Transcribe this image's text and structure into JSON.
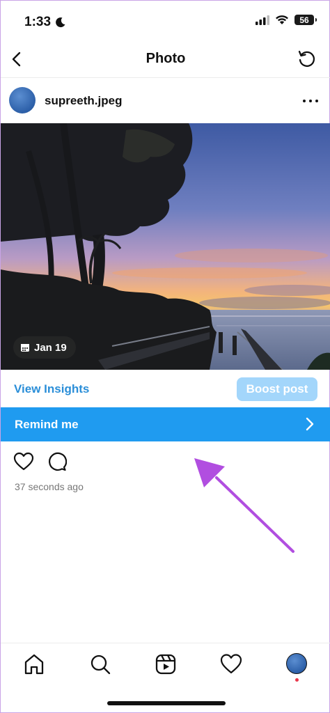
{
  "status_bar": {
    "time": "1:33",
    "battery": "56"
  },
  "header": {
    "title": "Photo"
  },
  "post": {
    "username": "supreeth.jpeg",
    "date_badge": "Jan 19",
    "view_insights": "View Insights",
    "boost_post": "Boost post",
    "remind_me": "Remind me",
    "timestamp": "37 seconds ago"
  },
  "colors": {
    "accent_blue": "#1f9bf0",
    "link_blue": "#2a8ed8",
    "boost_disabled": "#a3d6fb",
    "annotation_arrow": "#b14ee0"
  },
  "icons": {
    "status": [
      "moon-icon",
      "signal-icon",
      "wifi-icon",
      "battery-icon"
    ],
    "header": [
      "back-icon",
      "refresh-icon"
    ],
    "actions": [
      "heart-icon",
      "comment-icon"
    ],
    "bottom_nav": [
      "home-icon",
      "search-icon",
      "reels-icon",
      "heart-icon",
      "profile-avatar"
    ]
  }
}
